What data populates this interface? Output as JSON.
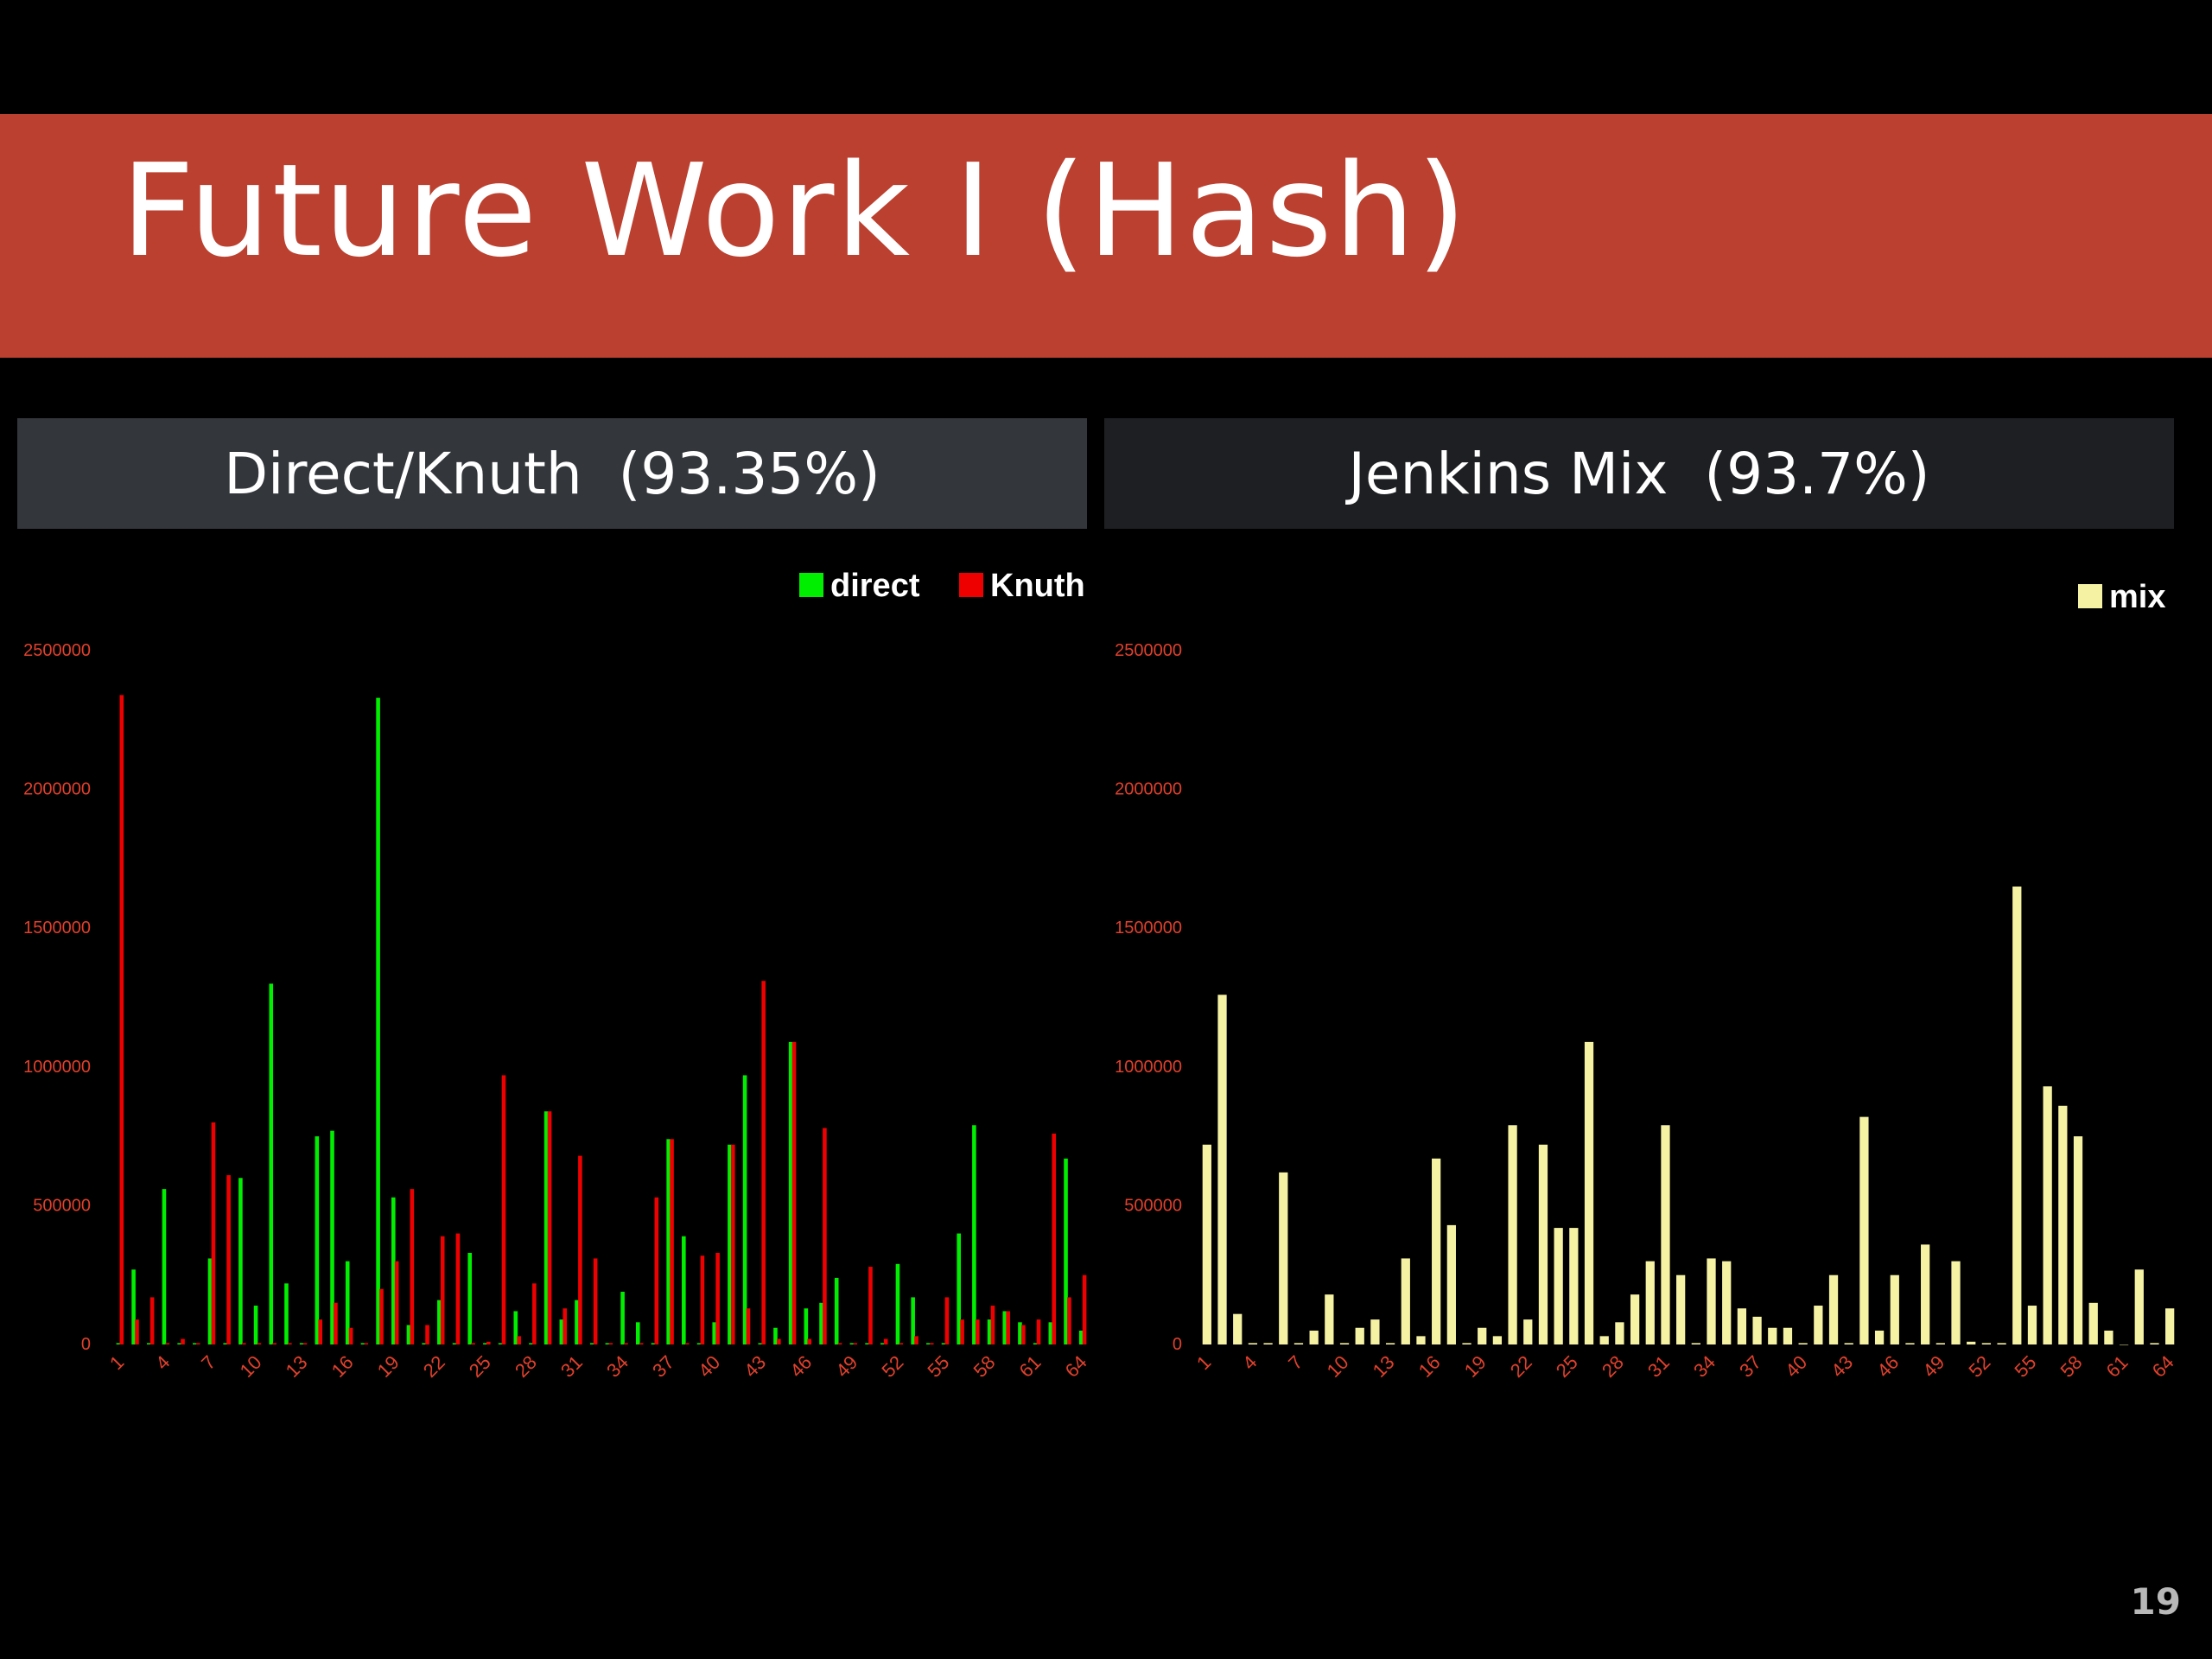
{
  "slide": {
    "title": "Future Work Ⅰ (Hash)",
    "page_number": "19",
    "colors": {
      "title_bar": "#bb4030",
      "tick_labels": "#e0402c",
      "background": "#000000"
    }
  },
  "panels": {
    "left_header": "Direct/Knuth  (93.35%)",
    "right_header": "Jenkins Mix  (93.7%)"
  },
  "chart_data": [
    {
      "type": "bar",
      "ylim": [
        0,
        2500000
      ],
      "yticks": [
        0,
        500000,
        1000000,
        1500000,
        2000000,
        2500000
      ],
      "xticks": [
        "1",
        "4",
        "7",
        "10",
        "13",
        "16",
        "19",
        "22",
        "25",
        "28",
        "31",
        "34",
        "37",
        "40",
        "43",
        "46",
        "49",
        "52",
        "55",
        "58",
        "61",
        "64"
      ],
      "categories": [
        "1",
        "2",
        "3",
        "4",
        "5",
        "6",
        "7",
        "8",
        "9",
        "10",
        "11",
        "12",
        "13",
        "14",
        "15",
        "16",
        "17",
        "18",
        "19",
        "20",
        "21",
        "22",
        "23",
        "24",
        "25",
        "26",
        "27",
        "28",
        "29",
        "30",
        "31",
        "32",
        "33",
        "34",
        "35",
        "36",
        "37",
        "38",
        "39",
        "40",
        "41",
        "42",
        "43",
        "44",
        "45",
        "46",
        "47",
        "48",
        "49",
        "50",
        "51",
        "52",
        "53",
        "54",
        "55",
        "56",
        "57",
        "58",
        "59",
        "60",
        "61",
        "62",
        "63",
        "64"
      ],
      "legend_position": "top-right",
      "series": [
        {
          "name": "direct",
          "color": "#00ee00",
          "values": [
            5000,
            270000,
            5000,
            560000,
            5000,
            5000,
            310000,
            5000,
            600000,
            140000,
            1300000,
            220000,
            5000,
            750000,
            770000,
            300000,
            5000,
            2330000,
            530000,
            70000,
            5000,
            160000,
            5000,
            330000,
            5000,
            5000,
            120000,
            5000,
            840000,
            90000,
            160000,
            5000,
            5000,
            190000,
            80000,
            5000,
            740000,
            390000,
            5000,
            80000,
            720000,
            970000,
            5000,
            60000,
            1090000,
            130000,
            150000,
            240000,
            5000,
            5000,
            5000,
            290000,
            170000,
            5000,
            5000,
            400000,
            790000,
            90000,
            120000,
            80000,
            5000,
            80000,
            670000,
            50000
          ]
        },
        {
          "name": "Knuth",
          "color": "#ee0000",
          "values": [
            2340000,
            90000,
            170000,
            5000,
            20000,
            5000,
            800000,
            610000,
            5000,
            5000,
            5000,
            5000,
            5000,
            90000,
            150000,
            60000,
            5000,
            200000,
            300000,
            560000,
            70000,
            390000,
            400000,
            5000,
            10000,
            970000,
            30000,
            220000,
            840000,
            130000,
            680000,
            310000,
            5000,
            5000,
            5000,
            530000,
            740000,
            5000,
            320000,
            330000,
            720000,
            130000,
            1310000,
            20000,
            1090000,
            20000,
            780000,
            5000,
            5000,
            280000,
            20000,
            5000,
            30000,
            5000,
            170000,
            90000,
            90000,
            140000,
            120000,
            70000,
            90000,
            760000,
            170000,
            250000
          ]
        }
      ]
    },
    {
      "type": "bar",
      "ylim": [
        0,
        2500000
      ],
      "yticks": [
        0,
        500000,
        1000000,
        1500000,
        2000000,
        2500000
      ],
      "xticks": [
        "1",
        "4",
        "7",
        "10",
        "13",
        "16",
        "19",
        "22",
        "25",
        "28",
        "31",
        "34",
        "37",
        "40",
        "43",
        "46",
        "49",
        "52",
        "55",
        "58",
        "61",
        "64"
      ],
      "legend_position": "top-right",
      "series": [
        {
          "name": "mix",
          "color": "#f6f2a4",
          "values": [
            720000,
            1260000,
            110000,
            5000,
            5000,
            620000,
            5000,
            50000,
            180000,
            5000,
            60000,
            90000,
            5000,
            310000,
            30000,
            670000,
            430000,
            5000,
            60000,
            30000,
            790000,
            90000,
            720000,
            420000,
            420000,
            1090000,
            30000,
            80000,
            180000,
            300000,
            790000,
            250000,
            5000,
            310000,
            300000,
            130000,
            100000,
            60000,
            60000,
            5000,
            140000,
            250000,
            5000,
            820000,
            50000,
            250000,
            5000,
            360000,
            5000,
            300000,
            10000,
            5000,
            5000,
            1650000,
            140000,
            930000,
            860000,
            750000,
            150000,
            50000,
            0,
            270000,
            5000,
            130000
          ]
        }
      ]
    }
  ]
}
